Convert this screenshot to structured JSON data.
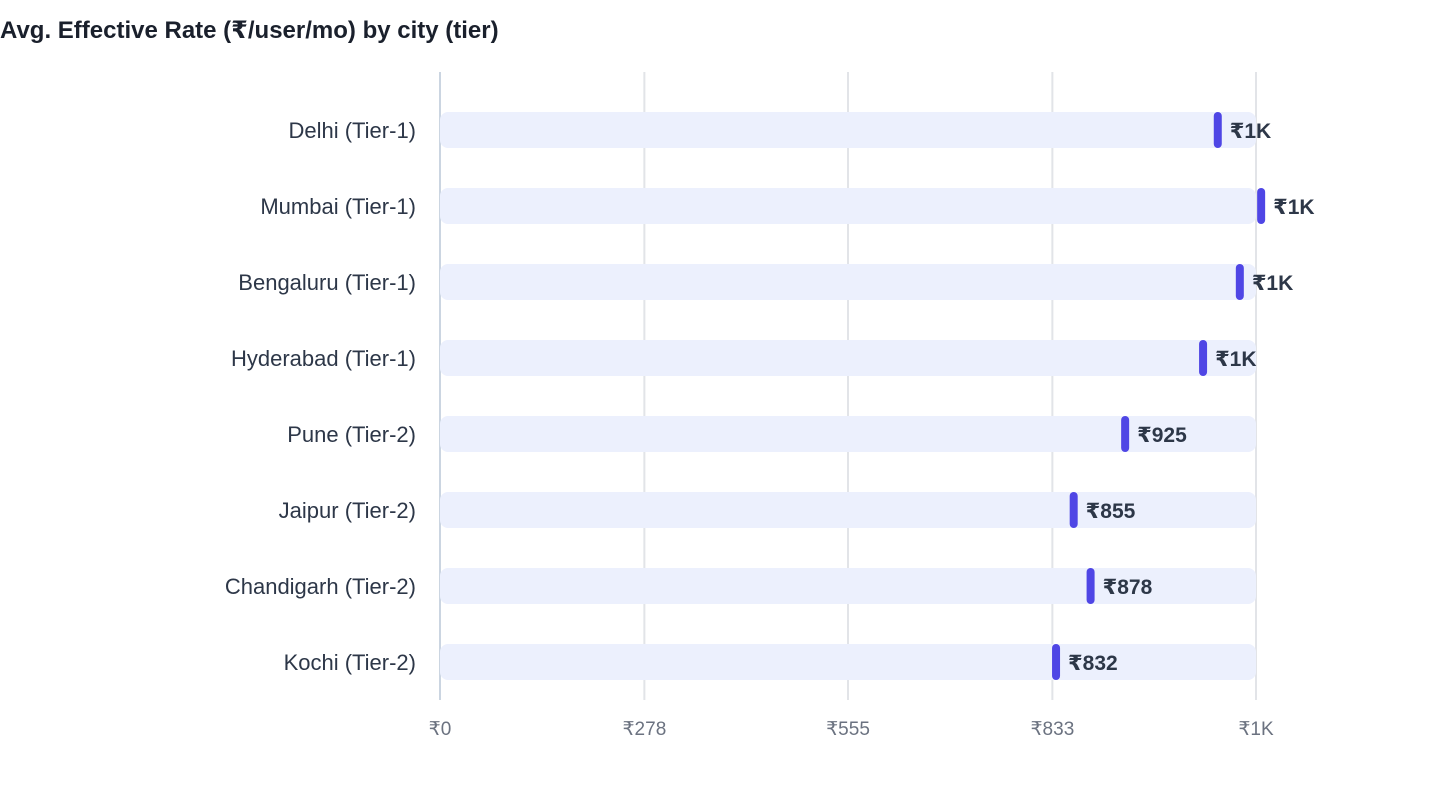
{
  "chart_data": {
    "type": "bar",
    "title": "Avg. Effective Rate (₹/user/mo) by city (tier)",
    "xlabel": "",
    "ylabel": "",
    "categories": [
      "Delhi (Tier-1)",
      "Mumbai (Tier-1)",
      "Bengaluru (Tier-1)",
      "Hyderabad (Tier-1)",
      "Pune (Tier-2)",
      "Jaipur (Tier-2)",
      "Chandigarh (Tier-2)",
      "Kochi (Tier-2)"
    ],
    "values": [
      1058,
      1117,
      1088,
      1038,
      932,
      862,
      885,
      838
    ],
    "data_labels": [
      "₹1K",
      "₹1K",
      "₹1K",
      "₹1K",
      "₹925",
      "₹855",
      "₹878",
      "₹832"
    ],
    "xlim": [
      0,
      1110
    ],
    "x_ticks": [
      0,
      278,
      555,
      833,
      1110
    ],
    "x_tick_labels": [
      "₹0",
      "₹278",
      "₹555",
      "₹833",
      "₹1K"
    ],
    "orientation": "horizontal",
    "grid": true,
    "colors": {
      "marker": "#4f46e5",
      "track": "#ecf0fd",
      "grid": "#e2e4e8",
      "axis": "#cbd5e1",
      "text": "#2d3748",
      "tick_text": "#6b7280"
    }
  }
}
